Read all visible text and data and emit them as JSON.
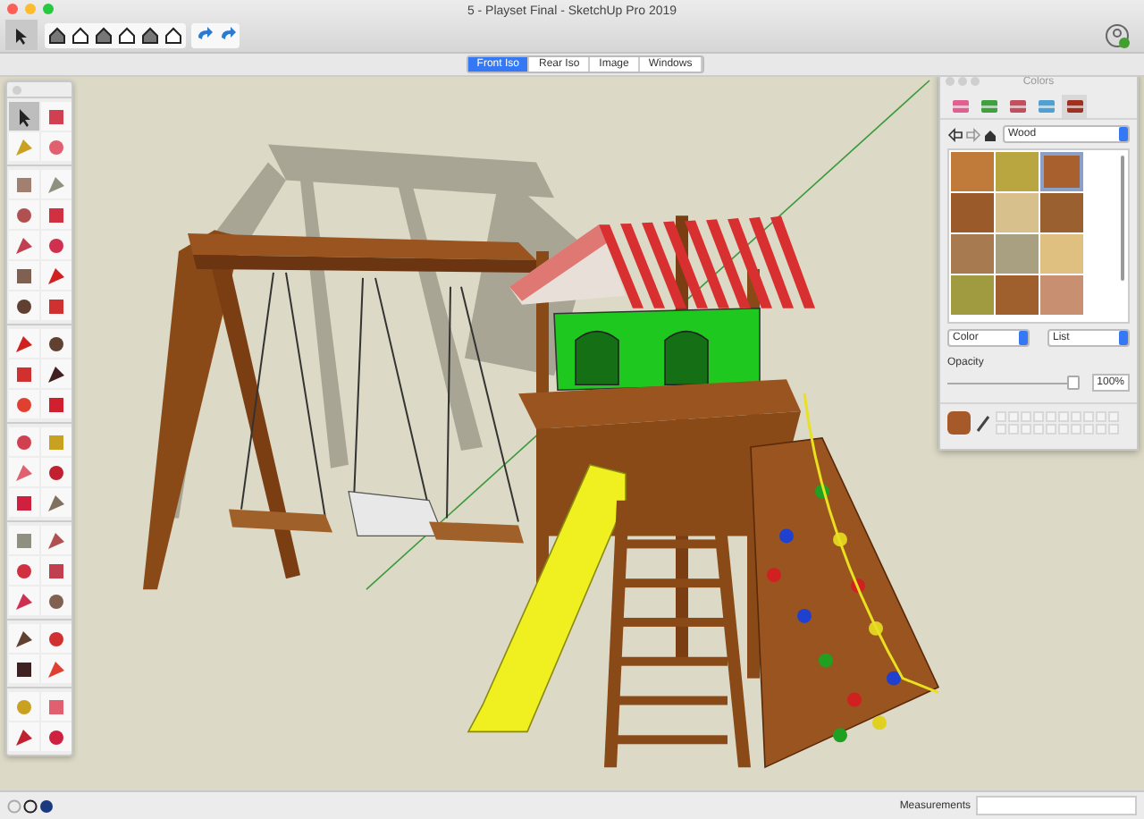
{
  "window": {
    "title": "5 - Playset Final - SketchUp Pro 2019"
  },
  "toolbar": {
    "groups": [
      {
        "tools": [
          {
            "selected": true
          }
        ]
      },
      {
        "tools": [
          {
            "selected": false
          },
          {
            "selected": false
          },
          {
            "selected": false
          },
          {
            "selected": false
          },
          {
            "selected": false
          },
          {
            "selected": false
          }
        ]
      },
      {
        "tools": [
          {
            "selected": false
          },
          {
            "selected": false
          }
        ]
      }
    ]
  },
  "scene_tabs": [
    {
      "label": "Front Iso",
      "selected": true
    },
    {
      "label": "Rear Iso",
      "selected": false
    },
    {
      "label": "Image",
      "selected": false
    },
    {
      "label": "Windows",
      "selected": false
    }
  ],
  "tool_palette": {
    "groups": [
      {
        "tools": [
          {
            "selected": true
          },
          {
            "selected": false
          },
          {
            "selected": false
          },
          {
            "selected": false
          }
        ]
      },
      {
        "tools": [
          {
            "selected": false
          },
          {
            "selected": false
          },
          {
            "selected": false
          },
          {
            "selected": false
          },
          {
            "selected": false
          },
          {
            "selected": false
          },
          {
            "selected": false
          },
          {
            "selected": false
          },
          {
            "selected": false
          },
          {
            "selected": false
          }
        ]
      },
      {
        "tools": [
          {
            "selected": false
          },
          {
            "selected": false
          },
          {
            "selected": false
          },
          {
            "selected": false
          },
          {
            "selected": false
          },
          {
            "selected": false
          }
        ]
      },
      {
        "tools": [
          {
            "selected": false
          },
          {
            "selected": false
          },
          {
            "selected": false
          },
          {
            "selected": false
          },
          {
            "selected": false
          },
          {
            "selected": false
          }
        ]
      },
      {
        "tools": [
          {
            "selected": false
          },
          {
            "selected": false
          },
          {
            "selected": false
          },
          {
            "selected": false
          },
          {
            "selected": false
          },
          {
            "selected": false
          }
        ]
      },
      {
        "tools": [
          {
            "selected": false
          },
          {
            "selected": false
          },
          {
            "selected": false
          },
          {
            "selected": false
          }
        ]
      },
      {
        "tools": [
          {
            "selected": false
          },
          {
            "selected": false
          },
          {
            "selected": false
          },
          {
            "selected": false
          }
        ]
      }
    ]
  },
  "colors_panel": {
    "title": "Colors",
    "tabs": [
      {
        "selected": false
      },
      {
        "selected": false
      },
      {
        "selected": false
      },
      {
        "selected": false
      },
      {
        "selected": true
      }
    ],
    "library": "Wood",
    "swatches": [
      {
        "color": "#c07a3a",
        "selected": false
      },
      {
        "color": "#b9a640",
        "selected": false
      },
      {
        "color": "#a8602e",
        "selected": true
      },
      {
        "color": "#9a5a2a",
        "selected": false
      },
      {
        "color": "#d8c08c",
        "selected": false
      },
      {
        "color": "#9a6030",
        "selected": false
      },
      {
        "color": "#a87a50",
        "selected": false
      },
      {
        "color": "#a8a080",
        "selected": false
      },
      {
        "color": "#e0c080",
        "selected": false
      },
      {
        "color": "#a09a40",
        "selected": false
      },
      {
        "color": "#a0602e",
        "selected": false
      },
      {
        "color": "#c89070",
        "selected": false
      }
    ],
    "mode": "Color",
    "view": "List",
    "opacity_label": "Opacity",
    "opacity": {
      "level": 1
    },
    "opacity_value": "100%"
  },
  "status_bar": {
    "measurements_label": "Measurements"
  }
}
